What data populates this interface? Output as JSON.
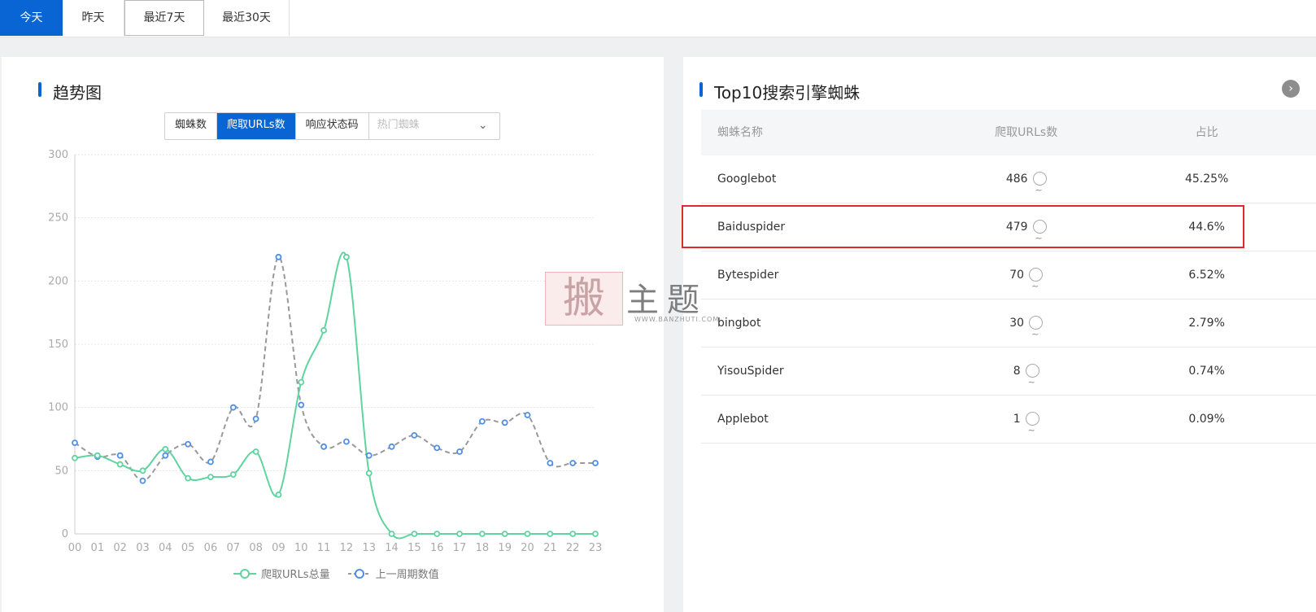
{
  "tabs": [
    "今天",
    "昨天",
    "最近7天",
    "最近30天"
  ],
  "left": {
    "title": "趋势图",
    "segments": [
      "蜘蛛数",
      "爬取URLs数",
      "响应状态码"
    ],
    "select_placeholder": "热门蜘蛛",
    "select_chevron": "chevron-down-icon"
  },
  "right": {
    "title": "Top10搜索引擎蜘蛛",
    "more_icon": "chevron-right-icon",
    "headers": [
      "蜘蛛名称",
      "爬取URLs数",
      "占比"
    ],
    "rows": [
      {
        "name": "Googlebot",
        "count": "486",
        "share": "45.25%"
      },
      {
        "name": "Baiduspider",
        "count": "479",
        "share": "44.6%"
      },
      {
        "name": "Bytespider",
        "count": "70",
        "share": "6.52%"
      },
      {
        "name": "bingbot",
        "count": "30",
        "share": "2.79%"
      },
      {
        "name": "YisouSpider",
        "count": "8",
        "share": "0.74%"
      },
      {
        "name": "Applebot",
        "count": "1",
        "share": "0.09%"
      }
    ]
  },
  "watermark": {
    "seal": "搬",
    "text": "主题",
    "url": "WWW.BANZHUTI.COM"
  },
  "colors": {
    "accent": "#0964d4",
    "series_current": "#5fd4a0",
    "series_previous": "#4f8fe8",
    "series_previous_line": "#999999",
    "highlight": "#e02a2a"
  },
  "chart_data": {
    "type": "line",
    "x": [
      "00",
      "01",
      "02",
      "03",
      "04",
      "05",
      "06",
      "07",
      "08",
      "09",
      "10",
      "11",
      "12",
      "13",
      "14",
      "15",
      "16",
      "17",
      "18",
      "19",
      "20",
      "21",
      "22",
      "23"
    ],
    "ylim": [
      0,
      300
    ],
    "yticks": [
      0,
      50,
      100,
      150,
      200,
      250,
      300
    ],
    "series": [
      {
        "name": "爬取URLs总量",
        "values": [
          60,
          62,
          55,
          50,
          67,
          44,
          45,
          47,
          65,
          31,
          120,
          161,
          219,
          48,
          0,
          0,
          0,
          0,
          0,
          0,
          0,
          0,
          0,
          0
        ]
      },
      {
        "name": "上一周期数值",
        "values": [
          72,
          61,
          62,
          42,
          62,
          71,
          57,
          100,
          91,
          219,
          102,
          69,
          73,
          62,
          69,
          78,
          68,
          65,
          89,
          88,
          94,
          56,
          56,
          56
        ]
      }
    ],
    "grid": true,
    "legend": "bottom-center"
  }
}
